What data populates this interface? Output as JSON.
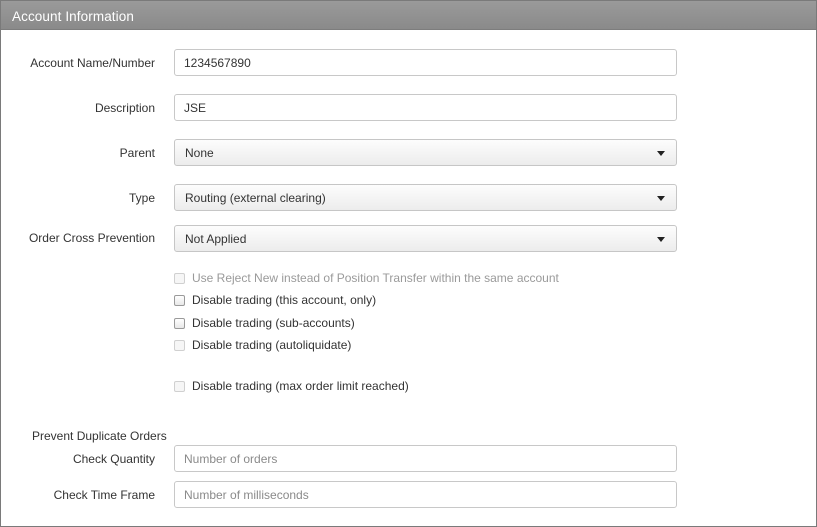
{
  "panel": {
    "title": "Account Information"
  },
  "fields": {
    "account_name": {
      "label": "Account Name/Number",
      "value": "1234567890"
    },
    "description": {
      "label": "Description",
      "value": "JSE"
    },
    "parent": {
      "label": "Parent",
      "value": "None"
    },
    "type": {
      "label": "Type",
      "value": "Routing (external clearing)"
    },
    "order_cross_prevention": {
      "label": "Order Cross Prevention",
      "value": "Not Applied"
    }
  },
  "checkboxes": [
    {
      "label": "Use Reject New instead of Position Transfer within the same account",
      "checked": false,
      "enabled": false
    },
    {
      "label": "Disable trading (this account, only)",
      "checked": false,
      "enabled": true
    },
    {
      "label": "Disable trading (sub-accounts)",
      "checked": false,
      "enabled": true
    },
    {
      "label": "Disable trading (autoliquidate)",
      "checked": false,
      "enabled": false
    },
    {
      "label": "Disable trading (max order limit reached)",
      "checked": false,
      "enabled": false
    }
  ],
  "duplicate_orders": {
    "section_label": "Prevent Duplicate Orders",
    "check_quantity": {
      "label": "Check Quantity",
      "value": "",
      "placeholder": "Number of orders"
    },
    "check_time_frame": {
      "label": "Check Time Frame",
      "value": "",
      "placeholder": "Number of milliseconds"
    }
  },
  "icons": {
    "dropdown_caret": "caret-down-icon"
  },
  "colors": {
    "header_bg": "#8f8f8f",
    "header_text": "#ffffff",
    "disabled_text": "#9a9a9a",
    "field_border": "#c8c8c8"
  }
}
